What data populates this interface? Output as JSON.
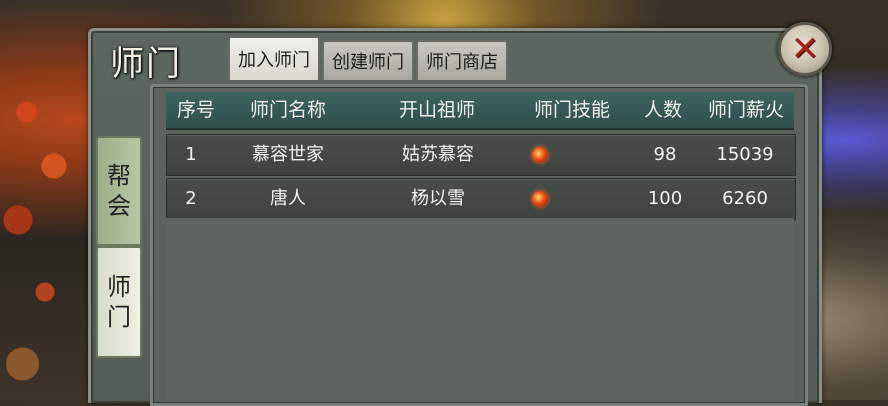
{
  "window": {
    "title": "师门",
    "close_label": "✕"
  },
  "tabs": [
    {
      "label": "加入师门",
      "active": true
    },
    {
      "label": "创建师门",
      "active": false
    },
    {
      "label": "师门商店",
      "active": false
    }
  ],
  "side_tabs": [
    {
      "label_line1": "帮",
      "label_line2": "会",
      "active": false
    },
    {
      "label_line1": "师",
      "label_line2": "门",
      "active": true
    }
  ],
  "table": {
    "columns": [
      "序号",
      "师门名称",
      "开山祖师",
      "师门技能",
      "人数",
      "师门薪火"
    ],
    "rows": [
      {
        "index": "1",
        "name": "慕容世家",
        "founder": "姑苏慕容",
        "skill_icon": "red-gem-icon",
        "members": "98",
        "heritage": "15039"
      },
      {
        "index": "2",
        "name": "唐人",
        "founder": "杨以雪",
        "skill_icon": "red-gem-icon",
        "members": "100",
        "heritage": "6260"
      }
    ]
  },
  "colors": {
    "header_bg": "#3e6460",
    "row_bg": "#4a4e4a",
    "panel_bg": "#5e6660",
    "close_x": "#a8201a"
  }
}
